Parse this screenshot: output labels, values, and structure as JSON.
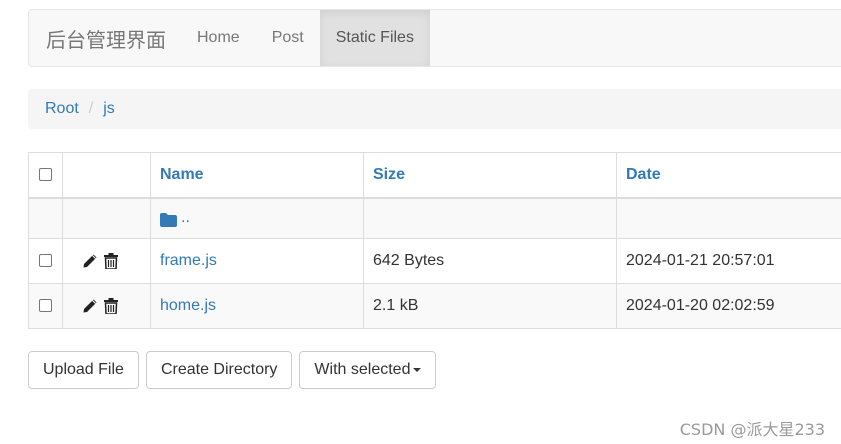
{
  "navbar": {
    "brand": "后台管理界面",
    "items": [
      {
        "label": "Home",
        "active": false
      },
      {
        "label": "Post",
        "active": false
      },
      {
        "label": "Static Files",
        "active": true
      }
    ]
  },
  "breadcrumb": {
    "root": "Root",
    "current": "js"
  },
  "table": {
    "headers": {
      "name": "Name",
      "size": "Size",
      "date": "Date"
    },
    "parent_dir": "..",
    "rows": [
      {
        "name": "frame.js",
        "size": "642 Bytes",
        "date": "2024-01-21 20:57:01"
      },
      {
        "name": "home.js",
        "size": "2.1 kB",
        "date": "2024-01-20 02:02:59"
      }
    ]
  },
  "buttons": {
    "upload": "Upload File",
    "create_dir": "Create Directory",
    "with_selected": "With selected"
  },
  "watermark": "CSDN @派大星233",
  "colors": {
    "link": "#337ab7",
    "navbar_bg": "#f8f8f8",
    "active_tab_bg": "#e1e1e1"
  },
  "icons": [
    "pencil-icon",
    "trash-icon",
    "folder-icon",
    "caret-down-icon"
  ]
}
